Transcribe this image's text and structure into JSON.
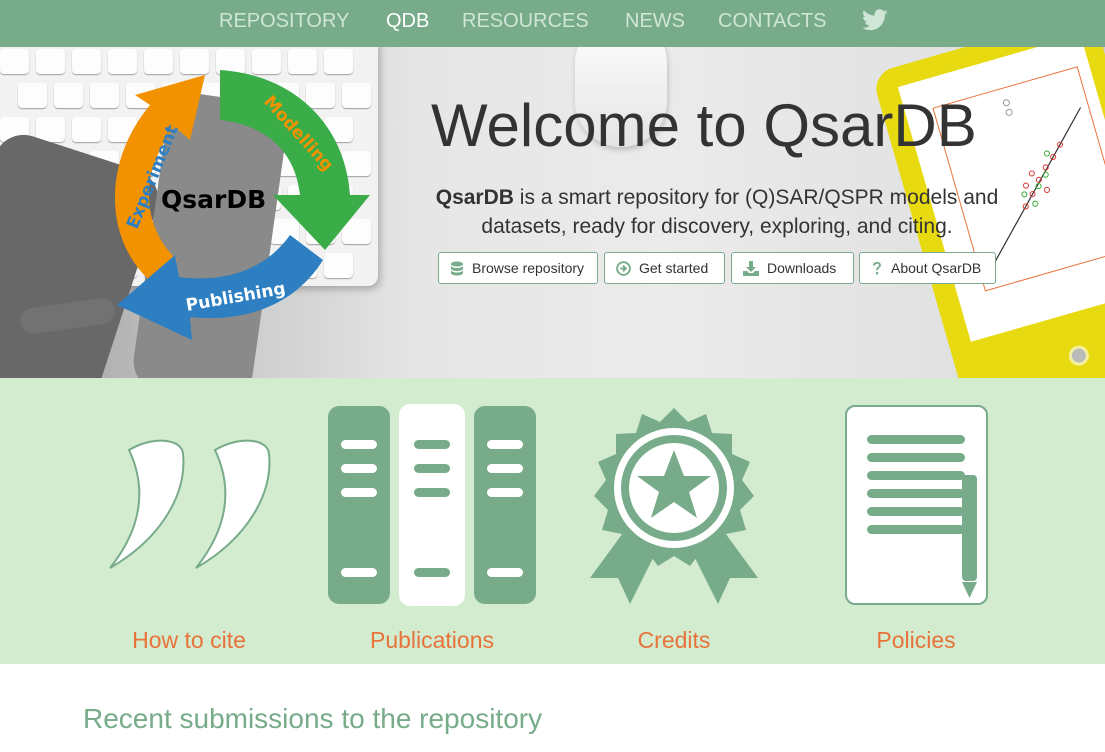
{
  "nav": {
    "items": [
      {
        "label": "REPOSITORY",
        "active": false
      },
      {
        "label": "QDB",
        "active": true
      },
      {
        "label": "RESOURCES",
        "active": false
      },
      {
        "label": "NEWS",
        "active": false
      },
      {
        "label": "CONTACTS",
        "active": false
      }
    ],
    "social_icon": "twitter-icon"
  },
  "hero": {
    "cycle": {
      "center_label": "QsarDB",
      "steps": [
        "Experiment",
        "Modelling",
        "Publishing"
      ]
    },
    "title": "Welcome to QsarDB",
    "description_strong": "QsarDB",
    "description_rest": " is a smart repository for (Q)SAR/QSPR models and datasets, ready for discovery, exploring, and citing.",
    "buttons": [
      {
        "label": "Browse repository",
        "icon": "database-icon"
      },
      {
        "label": "Get started",
        "icon": "arrow-circle-right-icon"
      },
      {
        "label": "Downloads",
        "icon": "download-icon"
      },
      {
        "label": "About QsarDB",
        "icon": "question-icon"
      }
    ]
  },
  "features": [
    {
      "label": "How to cite",
      "icon": "quote-icon"
    },
    {
      "label": "Publications",
      "icon": "books-icon"
    },
    {
      "label": "Credits",
      "icon": "award-icon"
    },
    {
      "label": "Policies",
      "icon": "document-pencil-icon"
    }
  ],
  "recent": {
    "title": "Recent submissions to the repository"
  },
  "colors": {
    "brand_green": "#77ab8a",
    "feature_band": "#d3ebcf",
    "feature_label": "#e8733a",
    "cycle_orange": "#f39200",
    "cycle_green": "#3aac48",
    "cycle_blue": "#2d7fc1"
  }
}
